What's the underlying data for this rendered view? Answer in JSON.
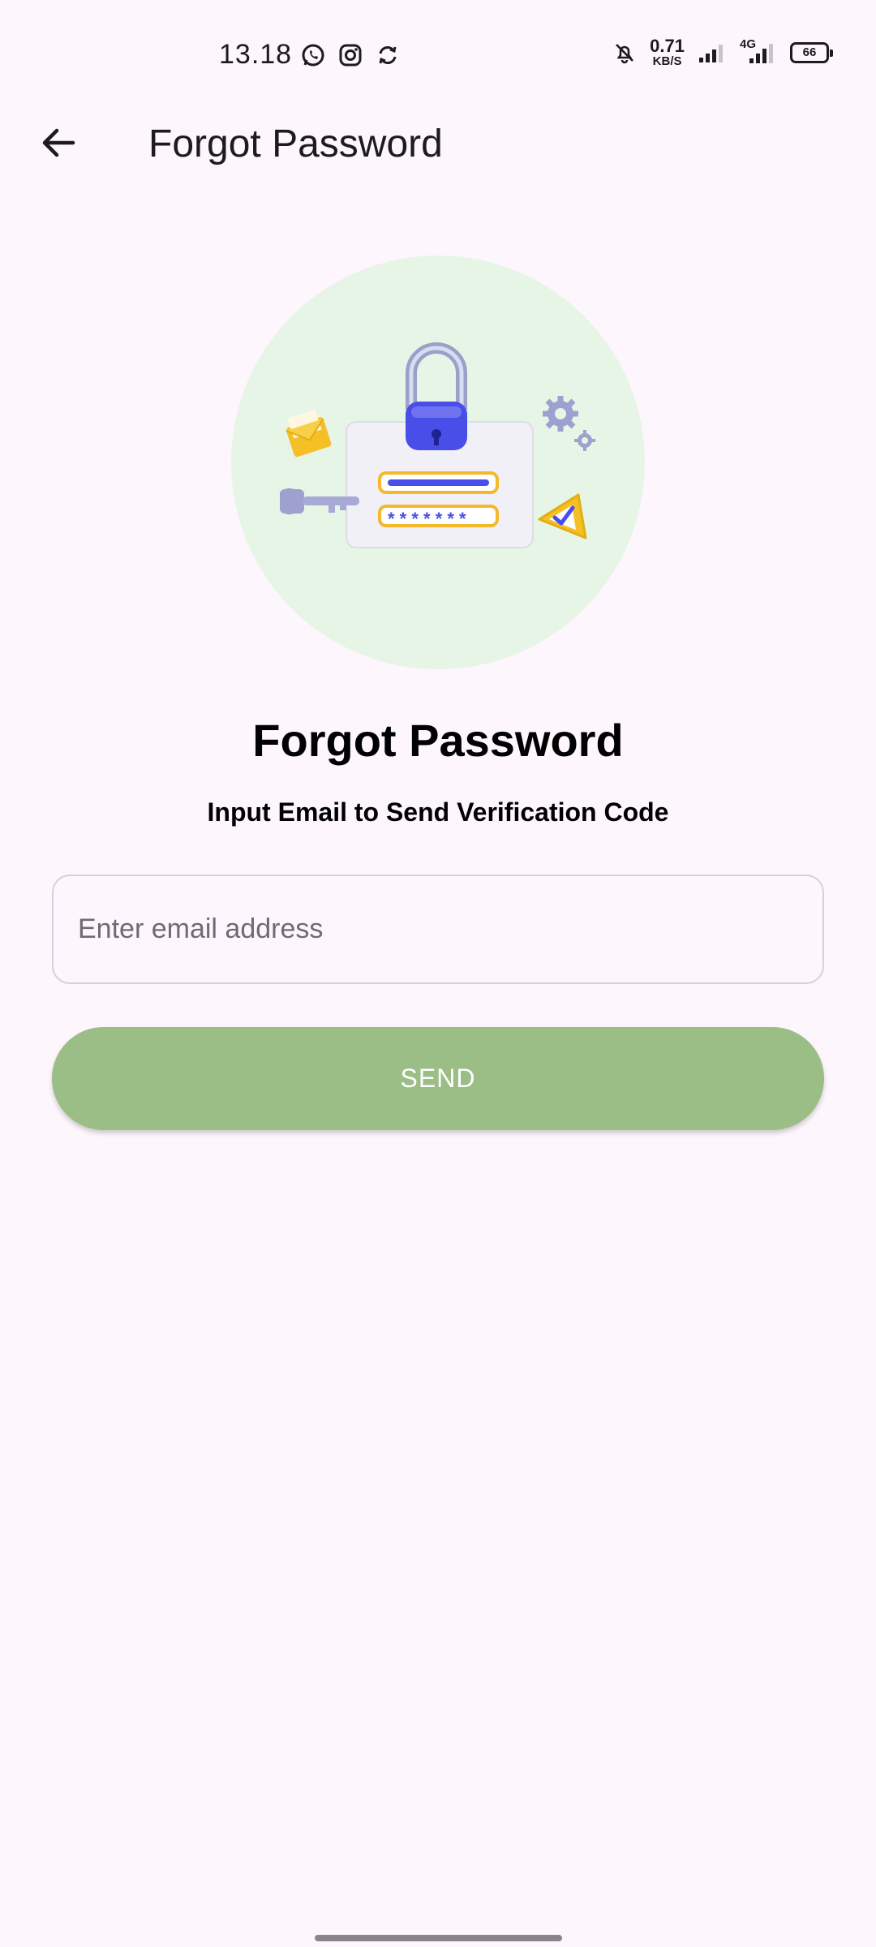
{
  "status_bar": {
    "time": "13.18",
    "net_speed_value": "0.71",
    "net_speed_unit": "KB/S",
    "network_type": "4G",
    "battery_level": "66",
    "icons": [
      "whatsapp-icon",
      "instagram-icon",
      "sync-icon",
      "bell-off-icon",
      "signal-icon",
      "signal-4g-icon",
      "battery-icon"
    ]
  },
  "app_bar": {
    "title": "Forgot Password",
    "back_icon": "arrow-left-icon"
  },
  "content": {
    "title": "Forgot Password",
    "subtitle": "Input Email to Send Verification Code",
    "email_value": "",
    "email_placeholder": "Enter email address",
    "send_label": "SEND"
  },
  "colors": {
    "background": "#fdf6fc",
    "illustration_circle": "#e7f5e7",
    "send_button": "#9bbd86",
    "lock_blue": "#4a4ee8",
    "accent_yellow": "#f5c025"
  }
}
